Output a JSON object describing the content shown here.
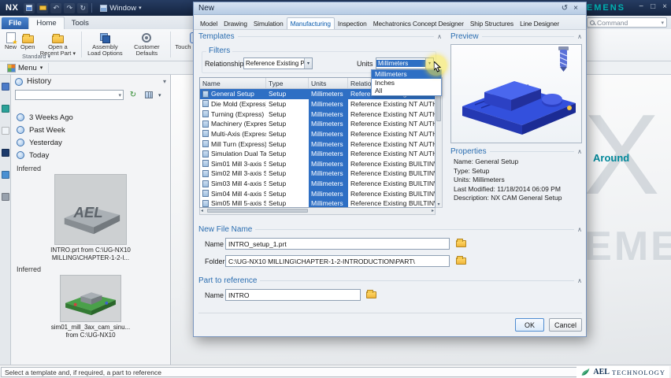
{
  "icons": {
    "caret_down": "▾",
    "chevron_up": "∧",
    "close": "×",
    "minimize": "−",
    "maximize": "□",
    "reset": "↺",
    "star": "★",
    "scroll_up": "▴",
    "scroll_down": "▾",
    "scroll_left": "◂",
    "scroll_right": "▸",
    "refresh": "↻",
    "undo": "↶",
    "redo": "↷"
  },
  "titlebar": {
    "app_logo": "NX",
    "window_menu_label": "Window",
    "brand": "SIEMENS"
  },
  "ribbon": {
    "file_tab": "File",
    "home_tab": "Home",
    "tools_tab": "Tools",
    "command_search_label": "Command",
    "buttons": [
      {
        "label": "New"
      },
      {
        "label": "Open"
      },
      {
        "label": "Open a Recent Part"
      },
      {
        "label": "Assembly Load Options"
      },
      {
        "label": "Customer Defaults"
      },
      {
        "label": "Touch Mode"
      },
      {
        "label": "Window"
      }
    ],
    "group_label": "Standard"
  },
  "menu_bar": {
    "menu_label": "Menu"
  },
  "history": {
    "title": "History",
    "groups": [
      "3 Weeks Ago",
      "Past Week",
      "Yesterday",
      "Today"
    ],
    "sections": [
      {
        "label": "Inferred",
        "thumb_text": "AEL",
        "caption_line1": "INTRO.prt from C:\\UG-NX10",
        "caption_line2": "MILLING\\CHAPTER-1-2-I..."
      },
      {
        "label": "Inferred",
        "caption_line1": "sim01_mill_3ax_cam_sinu...",
        "caption_line2": "from C:\\UG-NX10"
      }
    ]
  },
  "dialog": {
    "title": "New",
    "tabs": [
      "Model",
      "Drawing",
      "Simulation",
      "Manufacturing",
      "Inspection",
      "Mechatronics Concept Designer",
      "Ship Structures",
      "Line Designer"
    ],
    "active_tab": "Manufacturing",
    "templates": {
      "title": "Templates",
      "filters_title": "Filters",
      "relationship_label": "Relationship",
      "relationship_value": "Reference Existing Part",
      "units_label": "Units",
      "units_value": "Millimeters",
      "units_options": [
        "Millimeters",
        "Inches",
        "All"
      ],
      "table": {
        "headers": [
          "Name",
          "Type",
          "Units",
          "Relation..."
        ],
        "rows": [
          {
            "name": "General Setup",
            "type": "Setup",
            "units": "Millimeters",
            "relationship": "Reference Existing",
            "owner": "NT AUTH..."
          },
          {
            "name": "Die Mold (Express)",
            "type": "Setup",
            "units": "Millimeters",
            "relationship": "Reference Existing",
            "owner": "NT AUTH..."
          },
          {
            "name": "Turning (Express)",
            "type": "Setup",
            "units": "Millimeters",
            "relationship": "Reference Existing",
            "owner": "NT AUTH..."
          },
          {
            "name": "Machinery (Express)",
            "type": "Setup",
            "units": "Millimeters",
            "relationship": "Reference Existing",
            "owner": "NT AUTH..."
          },
          {
            "name": "Multi-Axis (Express)",
            "type": "Setup",
            "units": "Millimeters",
            "relationship": "Reference Existing",
            "owner": "NT AUTH..."
          },
          {
            "name": "Mill Turn (Express)",
            "type": "Setup",
            "units": "Millimeters",
            "relationship": "Reference Existing",
            "owner": "NT AUTH..."
          },
          {
            "name": "Simulation Dual Ta...",
            "type": "Setup",
            "units": "Millimeters",
            "relationship": "Reference Existing",
            "owner": "NT AUTH..."
          },
          {
            "name": "Sim01 Mill 3-axis Si...",
            "type": "Setup",
            "units": "Millimeters",
            "relationship": "Reference Existing",
            "owner": "BUILTIN\\A..."
          },
          {
            "name": "Sim02 Mill 3-axis Si...",
            "type": "Setup",
            "units": "Millimeters",
            "relationship": "Reference Existing",
            "owner": "BUILTIN\\A..."
          },
          {
            "name": "Sim03 Mill 4-axis Si...",
            "type": "Setup",
            "units": "Millimeters",
            "relationship": "Reference Existing",
            "owner": "BUILTIN\\A..."
          },
          {
            "name": "Sim04 Mill 4-axis Si...",
            "type": "Setup",
            "units": "Millimeters",
            "relationship": "Reference Existing",
            "owner": "BUILTIN\\A..."
          },
          {
            "name": "Sim05 Mill 5-axis Si...",
            "type": "Setup",
            "units": "Millimeters",
            "relationship": "Reference Existing",
            "owner": "BUILTIN\\A..."
          }
        ]
      }
    },
    "preview": {
      "title": "Preview"
    },
    "properties": {
      "title": "Properties",
      "lines": [
        "Name: General Setup",
        "Type: Setup",
        "Units: Millimeters",
        "Last Modified: 11/18/2014 06:09 PM",
        "Description: NX CAM General Setup"
      ]
    },
    "new_file_name": {
      "title": "New File Name",
      "name_label": "Name",
      "name_value": "INTRO_setup_1.prt",
      "folder_label": "Folder",
      "folder_value": "C:\\UG-NX10 MILLING\\CHAPTER-1-2-INTRODUCTION\\PART\\"
    },
    "part_to_reference": {
      "title": "Part to reference",
      "name_label": "Name",
      "name_value": "INTRO"
    },
    "ok_label": "OK",
    "cancel_label": "Cancel"
  },
  "statusbar": {
    "prompt": "Select a template and, if required, a part to reference"
  },
  "footer_logo": {
    "name": "AEL",
    "suffix": "TECHNOLOGY"
  },
  "watermark": {
    "around": "Around",
    "letter": "X",
    "ghost": "SIEMENS"
  }
}
